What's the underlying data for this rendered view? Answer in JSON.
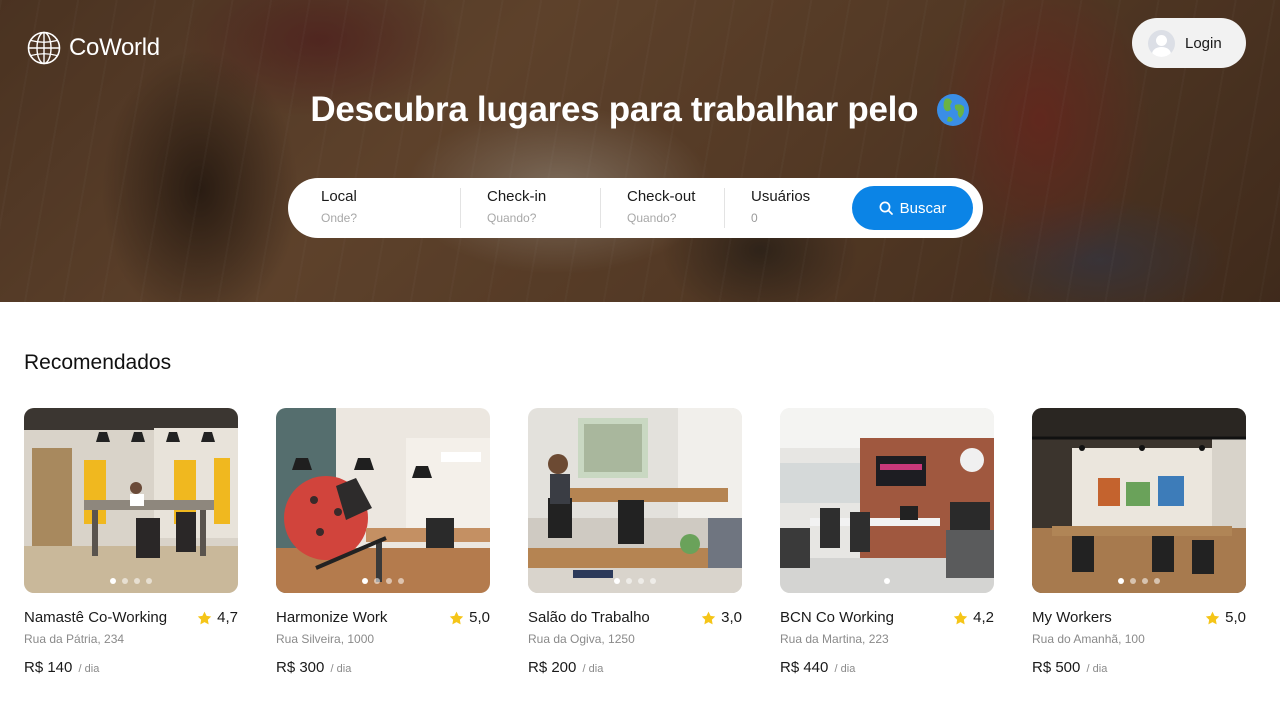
{
  "brand": {
    "name": "CoWorld",
    "logo_icon": "globe-outline-icon"
  },
  "header": {
    "login_label": "Login",
    "avatar_icon": "user-avatar-icon"
  },
  "hero": {
    "headline_part1": "Descubra lugares ",
    "headline_bold": "para trabalhar",
    "headline_part2": " pelo",
    "headline_icon": "earth-globe-emoji"
  },
  "search": {
    "location": {
      "label": "Local",
      "placeholder": "Onde?"
    },
    "checkin": {
      "label": "Check-in",
      "placeholder": "Quando?"
    },
    "checkout": {
      "label": "Check-out",
      "placeholder": "Quando?"
    },
    "users": {
      "label": "Usuários",
      "value": "0"
    },
    "button_label": "Buscar",
    "button_icon": "search-icon",
    "accent_color": "#0b84e6"
  },
  "recommended": {
    "title": "Recomendados",
    "star_color": "#f5c518",
    "items": [
      {
        "name": "Namastê Co-Working",
        "rating": "4,7",
        "address": "Rua da Pátria, 234",
        "price": "R$ 140",
        "unit": "/ dia",
        "photos": 4,
        "active_photo": 0
      },
      {
        "name": "Harmonize Work",
        "rating": "5,0",
        "address": "Rua Silveira, 1000",
        "price": "R$ 300",
        "unit": "/ dia",
        "photos": 4,
        "active_photo": 0
      },
      {
        "name": "Salão do Trabalho",
        "rating": "3,0",
        "address": "Rua da Ogiva, 1250",
        "price": "R$ 200",
        "unit": "/ dia",
        "photos": 4,
        "active_photo": 0
      },
      {
        "name": "BCN Co Working",
        "rating": "4,2",
        "address": "Rua da Martina, 223",
        "price": "R$ 440",
        "unit": "/ dia",
        "photos": 1,
        "active_photo": 0
      },
      {
        "name": "My Workers",
        "rating": "5,0",
        "address": "Rua do Amanhã, 100",
        "price": "R$ 500",
        "unit": "/ dia",
        "photos": 4,
        "active_photo": 0
      }
    ]
  }
}
